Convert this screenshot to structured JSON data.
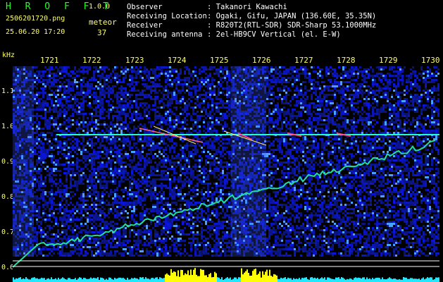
{
  "app": {
    "name": "H R O F F T",
    "version": "1.0.0"
  },
  "file": {
    "name": "2506201720.png",
    "datetime": "25.06.20 17:20"
  },
  "meteor": {
    "label": "meteor",
    "count": "37"
  },
  "info": [
    {
      "key": "Observer",
      "value": ": Takanori Kawachi"
    },
    {
      "key": "Receiving Location",
      "value": ": Ogaki, Gifu, JAPAN (136.60E, 35.35N)"
    },
    {
      "key": "Receiver",
      "value": ": R820T2(RTL-SDR) SDR-Sharp 53.1000MHz"
    },
    {
      "key": "Receiving antenna",
      "value": ": 2el-HB9CV Vertical (el. E-W)"
    }
  ],
  "time_ticks": [
    "1721",
    "1722",
    "1723",
    "1724",
    "1725",
    "1726",
    "1727",
    "1728",
    "1729",
    "1730"
  ],
  "freq_unit": "kHz",
  "freq_ticks": [
    "1.1",
    "1.0",
    "0.9",
    "0.8",
    "0.7",
    "0.6"
  ],
  "colors": {
    "text_green": "#22ff22",
    "text_yellow": "#ffff66",
    "background": "#000000",
    "noise": "#0b1a8a",
    "carrier": "#20ffd0",
    "level_bar": "#ffff00"
  }
}
